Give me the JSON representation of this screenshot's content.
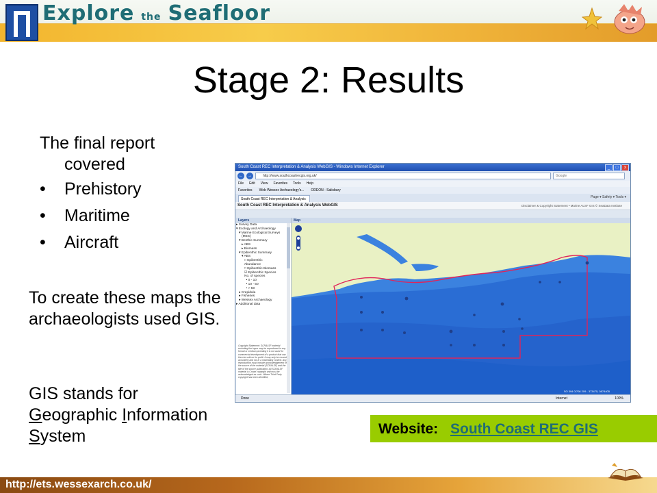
{
  "header": {
    "title_part1": "Explore",
    "title_part2": "the",
    "title_part3": "Seafloor"
  },
  "slide": {
    "title": "Stage 2: Results",
    "intro_line1": "The final report",
    "intro_line2": "covered",
    "bullets": [
      {
        "dot": "•",
        "text": "Prehistory"
      },
      {
        "dot": "•",
        "text": "Maritime"
      },
      {
        "dot": "•",
        "text": "Aircraft"
      }
    ],
    "para1": "To create these maps the archaeologists used GIS.",
    "para2_line1": "GIS stands for",
    "para2_G": "G",
    "para2_eographic": "eographic ",
    "para2_I": "I",
    "para2_nformation": "nformation",
    "para2_S": "S",
    "para2_ystem": "ystem"
  },
  "website": {
    "label": "Website:",
    "link": "South Coast REC GIS"
  },
  "footer": {
    "url": "http://ets.wessexarch.co.uk/"
  },
  "browser": {
    "window_title": "South Coast REC Interpretation & Analysis WebGIS - Windows Internet Explorer",
    "window_buttons": [
      "_",
      "□",
      "x"
    ],
    "nav_back": "←",
    "nav_forward": "→",
    "address": "http://www.southcoastrecgis.org.uk/",
    "search_placeholder": "Google",
    "menu": [
      "File",
      "Edit",
      "View",
      "Favorites",
      "Tools",
      "Help"
    ],
    "favorites": [
      "Favorites",
      "Web Wessex Archaeology's...",
      "ODEON - Salisbury"
    ],
    "tab_label": "South Coast REC Interpretation & Analysis WebGIS",
    "tab_tools": "Page ▾   Safety ▾   Tools ▾",
    "app_title": "South Coast REC Interpretation & Analysis WebGIS",
    "app_links": "Disclaimer & Copyright Statement • Marine ALSF GIS © SeaData Institute",
    "layers_header": "Layers",
    "map_header": "Map",
    "layers": [
      "▸ Survey Data",
      "▾ Ecology and Archaeology",
      "   ▾ Marine Ecological Surveys",
      "      (MES)",
      "   ▾ Benthic Summary",
      "      ▸ ABS",
      "      ▸ Biomass",
      "   ▾ Epibenthic Summary",
      "      ▾ ABS",
      "         □ Epibenthic",
      "         Abundance",
      "         □ Epibenthic Biomass",
      "         ☑ Epibenthic Species",
      "         No. of species",
      "           • 0 - 10",
      "           • 10 - 50",
      "           • > 50",
      "   ▸ Crepidula",
      "   ▸ Fisheries",
      "   ▸ Wessex Archaeology",
      "▸ Additional data"
    ],
    "copyright": "Copyright Statement: SCRALSF material excluding the logos may be reproduced in any format or medium providing it is not used for commercial development of a product that can then be sold on for profit. It may only be reused accurately and not in a misleading context. Any reproduction must include acknowledgement of the source of the material (SCRALSF) and the title of the source publication. All SCRALSF material is Crown copyright and must be acknowledged as such. Where Third Party copyright has been identified,",
    "coords": "SO 394 0/708 209 - 373475, 0874405",
    "status_done": "Done",
    "status_zone": "Internet",
    "status_zoom": "100%",
    "colors": {
      "land": "#e9f1c4",
      "shallow": "#5fa2e6",
      "deep": "#2f74d8",
      "deepest": "#1e5fc9",
      "boundary": "#e0245a"
    }
  },
  "colors": {
    "banner_text": "#1f6d75",
    "website_bg": "#99cc00",
    "website_link": "#1f6d75",
    "footer_bg": "#9c5418"
  }
}
